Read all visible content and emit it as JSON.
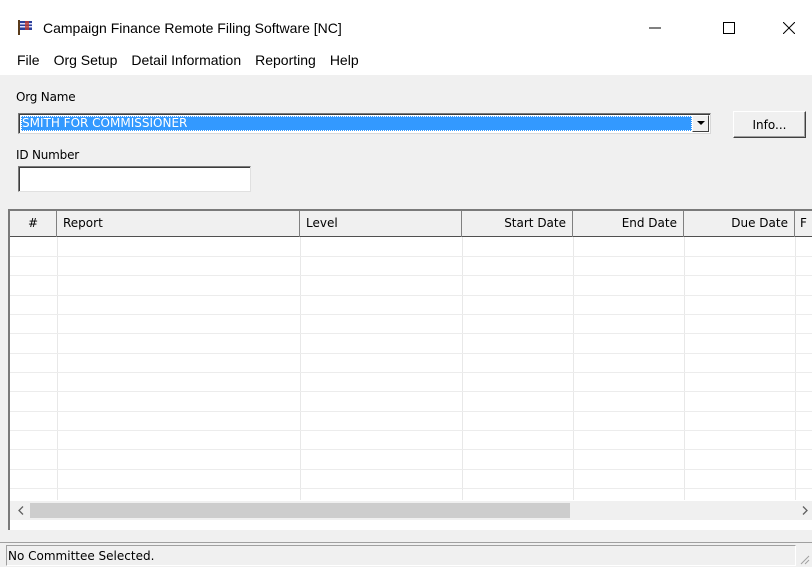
{
  "window": {
    "title": "Campaign Finance Remote Filing Software [NC]",
    "icon": "campaign-flag-icon",
    "controls": {
      "minimize": "minimize-icon",
      "maximize": "maximize-icon",
      "close": "close-icon"
    }
  },
  "menu": [
    {
      "label": "File"
    },
    {
      "label": "Org Setup"
    },
    {
      "label": "Detail Information"
    },
    {
      "label": "Reporting"
    },
    {
      "label": "Help"
    }
  ],
  "form": {
    "org_name_label": "Org Name",
    "org_name_value": "SMITH FOR COMMISSIONER",
    "info_button": "Info...",
    "id_number_label": "ID Number",
    "id_number_value": ""
  },
  "grid": {
    "columns": [
      "#",
      "Report",
      "Level",
      "Start Date",
      "End Date",
      "Due Date",
      "F"
    ],
    "rows": []
  },
  "status": {
    "text": "No Committee Selected."
  },
  "colors": {
    "selection": "#3399ff",
    "window_bg": "#f0f0f0"
  }
}
